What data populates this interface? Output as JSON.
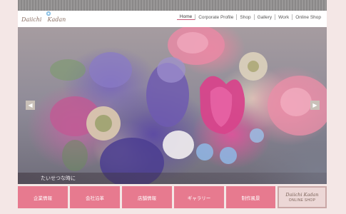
{
  "logo": {
    "word1": "Daiichi",
    "word2": "Kadan"
  },
  "nav": {
    "items": [
      {
        "label": "Home",
        "active": true
      },
      {
        "label": "Corporate Profile"
      },
      {
        "label": "Shop"
      },
      {
        "label": "Gallery"
      },
      {
        "label": "Work"
      },
      {
        "label": "Online Shop"
      }
    ]
  },
  "hero": {
    "caption": "たいせつな時に",
    "prev_icon": "chevron-left-icon",
    "next_icon": "chevron-right-icon"
  },
  "menu": {
    "buttons": [
      "企業情報",
      "会社沿革",
      "店舗情報",
      "ギャラリー",
      "制作風景"
    ],
    "shop_banner": {
      "title": "Daiichi Kadan",
      "subtitle": "ONLINE SHOP"
    }
  },
  "colors": {
    "accent": "#e77a8f",
    "background": "#f4e7e6",
    "top_strip": "#8a8888"
  }
}
